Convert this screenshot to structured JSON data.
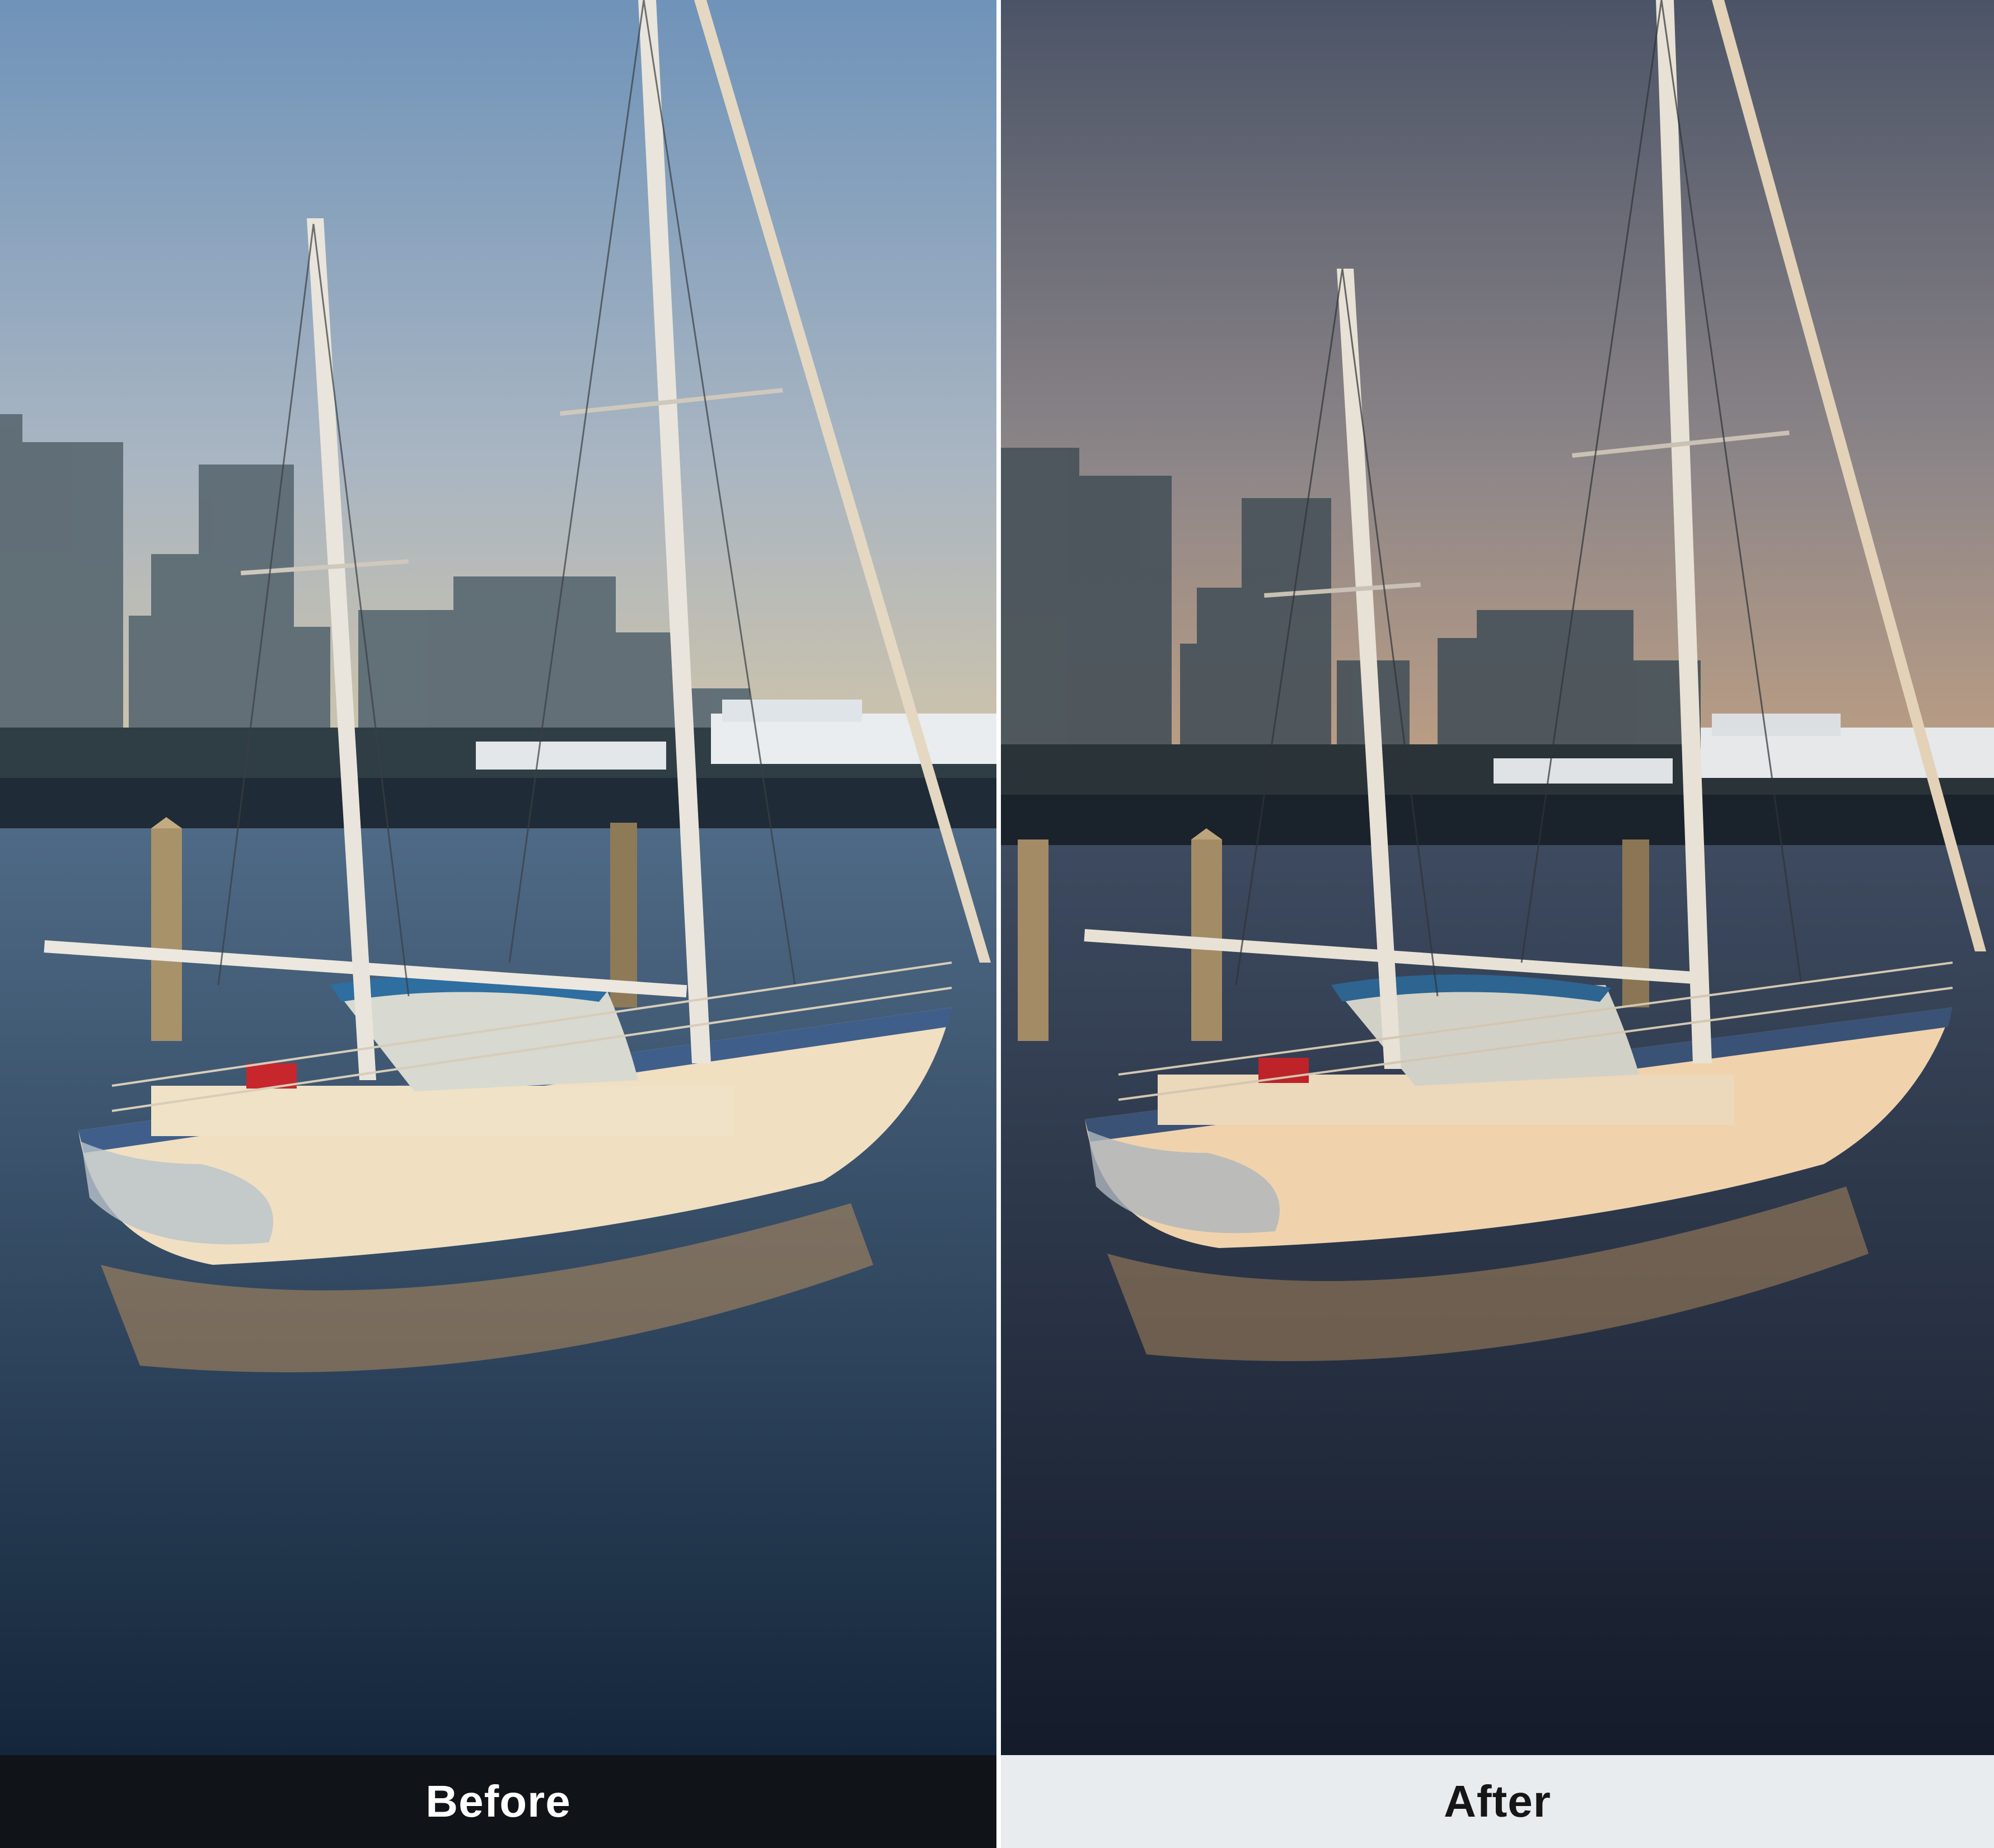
{
  "labels": {
    "before": "Before",
    "after": "After"
  },
  "palette": {
    "before": {
      "sky_top": "#6f93b9",
      "sky_bottom": "#d8c7a4",
      "water_top": "#4f6a86",
      "water_bottom": "#14263b",
      "hull": "#f1dfc2",
      "stripe": "#3f5f8a",
      "canopy": "#2f6ea0",
      "label_bar": "#101317",
      "label_text": "#ffffff"
    },
    "after": {
      "sky_top": "#4b5467",
      "sky_bottom": "#c9a583",
      "water_top": "#3d4a5f",
      "water_bottom": "#141b2a",
      "hull": "#f0d3ad",
      "stripe": "#3a5275",
      "canopy": "#2d6490",
      "label_bar": "#e9ecef",
      "label_text": "#161616"
    }
  }
}
